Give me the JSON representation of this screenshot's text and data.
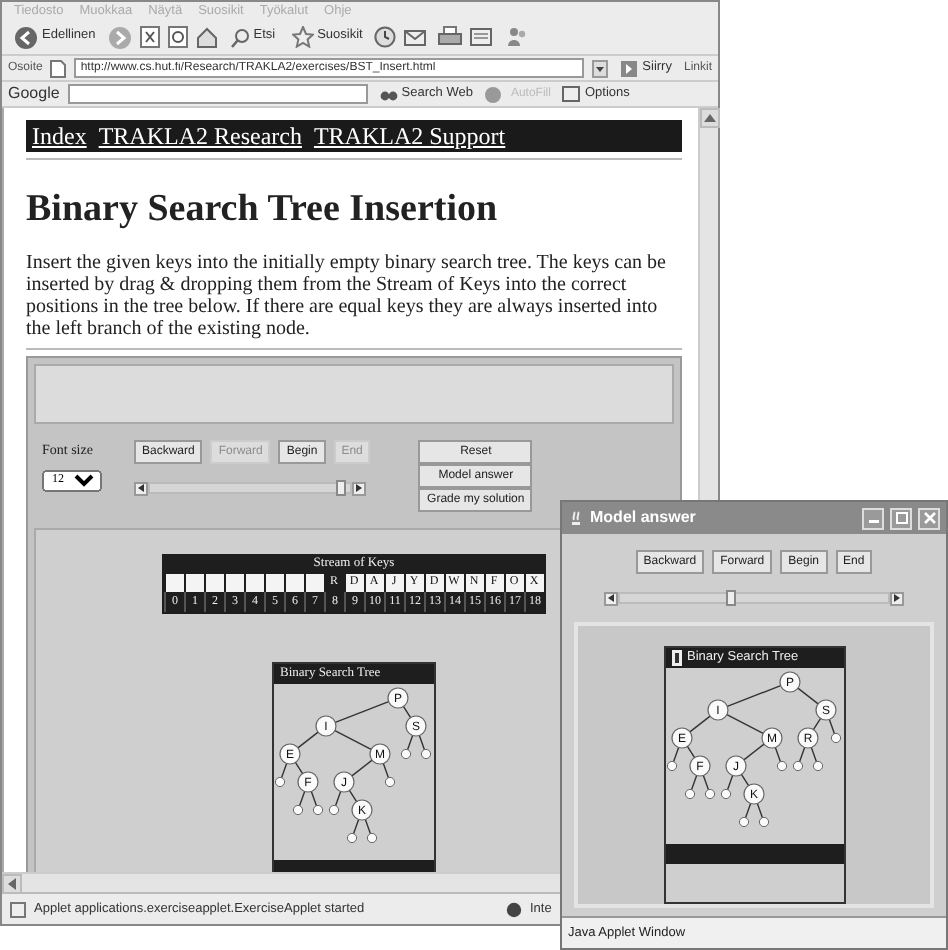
{
  "browser": {
    "menu": [
      "Tiedosto",
      "Muokkaa",
      "Näytä",
      "Suosikit",
      "Työkalut",
      "Ohje"
    ],
    "toolbar": {
      "back": "Edellinen",
      "search": "Etsi",
      "favorites": "Suosikit"
    },
    "address": {
      "label": "Osoite",
      "url": "http://www.cs.hut.fi/Research/TRAKLA2/exercises/BST_Insert.html",
      "go": "Siirry",
      "links": "Linkit"
    },
    "google": {
      "logo": "Google",
      "search": "Search Web",
      "autofill": "AutoFill",
      "options": "Options"
    }
  },
  "page": {
    "nav": [
      "Index",
      "TRAKLA2 Research",
      "TRAKLA2 Support"
    ],
    "title": "Binary Search Tree Insertion",
    "intro": "Insert the given keys into the initially empty binary search tree. The keys can be inserted by drag & dropping them from the Stream of Keys into the correct positions in the tree below. If there are equal keys they are always inserted into the left branch of the existing node."
  },
  "applet": {
    "font_size_label": "Font size",
    "font_size": "12",
    "buttons": [
      {
        "label": "Backward",
        "disabled": false
      },
      {
        "label": "Forward",
        "disabled": true
      },
      {
        "label": "Begin",
        "disabled": false
      },
      {
        "label": "End",
        "disabled": true
      }
    ],
    "slider": {
      "level": 1
    },
    "actions": [
      "Reset",
      "Model answer",
      "Grade my solution"
    ],
    "stream": {
      "title": "Stream of Keys",
      "slots": [
        {
          "index": "0",
          "selected": false
        },
        {
          "index": "1",
          "selected": false
        },
        {
          "index": "2",
          "selected": false
        },
        {
          "index": "3",
          "selected": false
        },
        {
          "index": "4",
          "selected": false
        },
        {
          "index": "5",
          "selected": false
        },
        {
          "index": "6",
          "selected": false
        },
        {
          "index": "7",
          "selected": false
        },
        {
          "index": "8",
          "key": "R",
          "selected": true
        },
        {
          "index": "9",
          "key": "D",
          "selected": false
        },
        {
          "index": "10",
          "key": "A",
          "selected": false
        },
        {
          "index": "11",
          "key": "J",
          "selected": false
        },
        {
          "index": "12",
          "key": "Y",
          "selected": false
        },
        {
          "index": "13",
          "key": "D",
          "selected": false
        },
        {
          "index": "14",
          "key": "W",
          "selected": false
        },
        {
          "index": "15",
          "key": "N",
          "selected": false
        },
        {
          "index": "16",
          "key": "F",
          "selected": false
        },
        {
          "index": "17",
          "key": "O",
          "selected": false
        },
        {
          "index": "18",
          "key": "X",
          "selected": false
        }
      ]
    },
    "tree": {
      "title": "Binary Search Tree",
      "root": {
        "kind": "key",
        "label": "P",
        "children": [
          {
            "kind": "key",
            "label": "I",
            "children": [
              {
                "kind": "key",
                "label": "E",
                "children": [
                  {
                    "kind": "empty"
                  },
                  {
                    "kind": "key",
                    "label": "F",
                    "children": [
                      {
                        "kind": "empty"
                      },
                      {
                        "kind": "empty"
                      }
                    ]
                  }
                ]
              },
              {
                "kind": "key",
                "label": "M",
                "children": [
                  {
                    "kind": "key",
                    "label": "J",
                    "children": [
                      {
                        "kind": "empty"
                      },
                      {
                        "kind": "key",
                        "label": "K",
                        "children": [
                          {
                            "kind": "empty"
                          },
                          {
                            "kind": "empty"
                          }
                        ]
                      }
                    ]
                  },
                  {
                    "kind": "empty"
                  }
                ]
              }
            ]
          },
          {
            "kind": "key",
            "label": "S",
            "children": [
              {
                "kind": "empty"
              },
              {
                "kind": "empty"
              }
            ]
          }
        ]
      }
    }
  },
  "model_window": {
    "title": "Model answer",
    "buttons": [
      {
        "label": "Backward",
        "disabled": false
      },
      {
        "label": "Forward",
        "disabled": false
      },
      {
        "label": "Begin",
        "disabled": false
      },
      {
        "label": "End",
        "disabled": false
      }
    ],
    "slider": {
      "level": 0.42
    },
    "tree": {
      "title": "Binary Search Tree",
      "root": {
        "kind": "key",
        "label": "P",
        "children": [
          {
            "kind": "key",
            "label": "I",
            "children": [
              {
                "kind": "key",
                "label": "E",
                "children": [
                  {
                    "kind": "empty"
                  },
                  {
                    "kind": "key",
                    "label": "F",
                    "children": [
                      {
                        "kind": "empty"
                      },
                      {
                        "kind": "empty"
                      }
                    ]
                  }
                ]
              },
              {
                "kind": "key",
                "label": "M",
                "children": [
                  {
                    "kind": "key",
                    "label": "J",
                    "children": [
                      {
                        "kind": "empty"
                      },
                      {
                        "kind": "key",
                        "label": "K",
                        "children": [
                          {
                            "kind": "empty"
                          },
                          {
                            "kind": "empty"
                          }
                        ]
                      }
                    ]
                  },
                  {
                    "kind": "empty"
                  }
                ]
              }
            ]
          },
          {
            "kind": "key",
            "label": "S",
            "children": [
              {
                "kind": "key",
                "label": "R",
                "children": [
                  {
                    "kind": "empty"
                  },
                  {
                    "kind": "empty"
                  }
                ]
              },
              {
                "kind": "empty"
              }
            ]
          }
        ]
      }
    },
    "status": "Java Applet Window"
  },
  "status_bar": {
    "text": "Applet applications.exerciseapplet.ExerciseApplet started",
    "zone": "Inte"
  }
}
